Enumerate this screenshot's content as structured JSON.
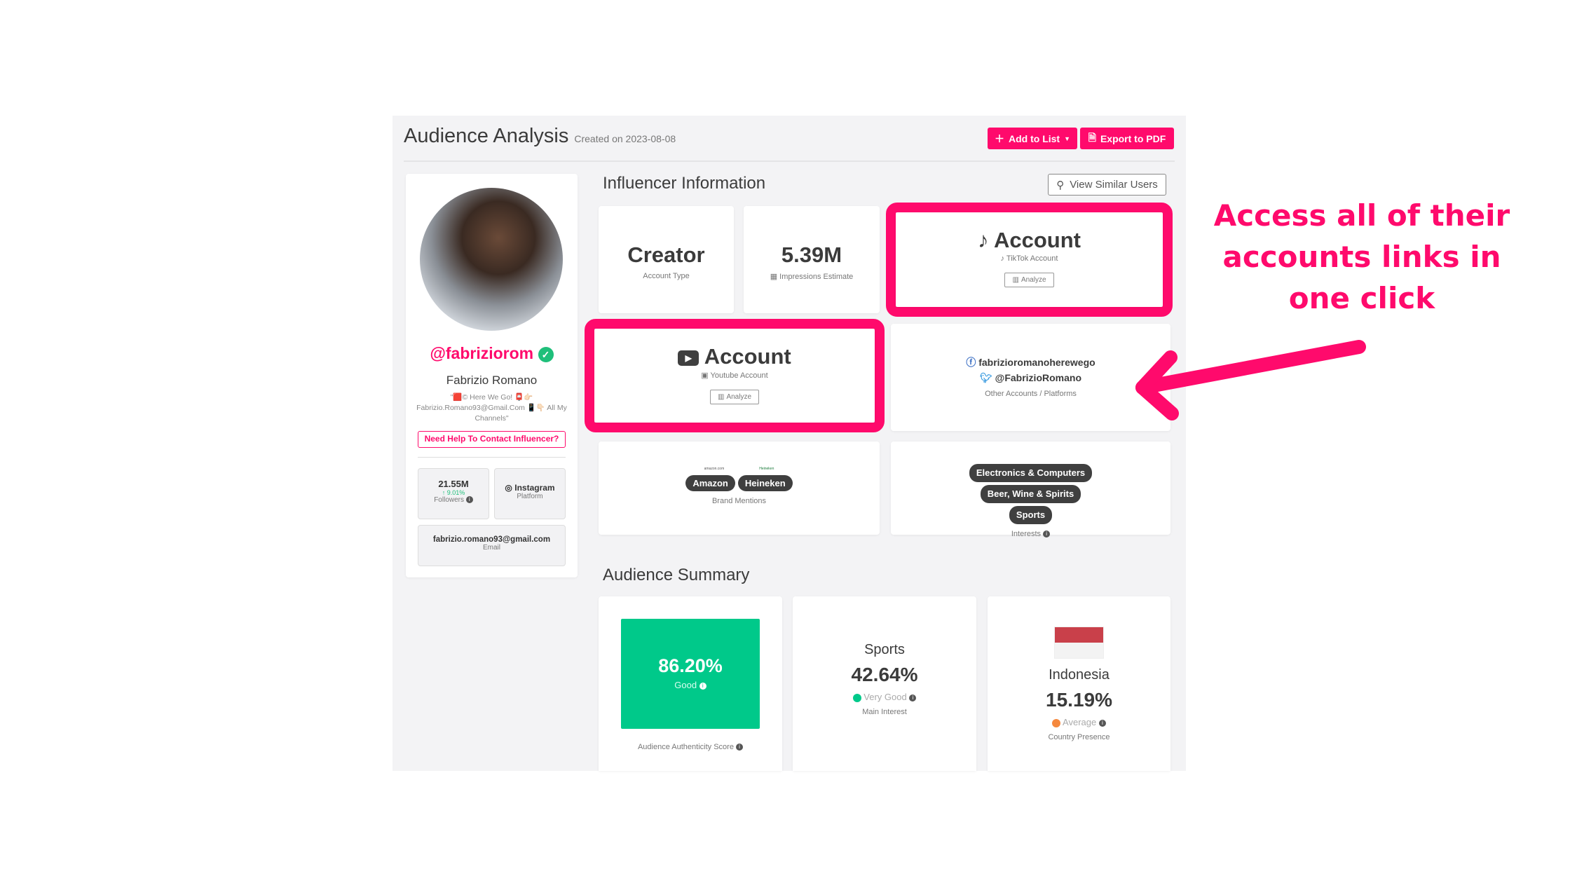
{
  "header": {
    "title": "Audience Analysis",
    "created": "Created on 2023-08-08",
    "add_to_list": "Add to List",
    "export_pdf": "Export to PDF"
  },
  "profile": {
    "handle": "@fabriziorom",
    "name": "Fabrizio Romano",
    "bio": "\"🟥© Here We Go! 📮👉🏻 Fabrizio.Romano93@Gmail.Com 📱👇🏻 All My Channels\"",
    "contact_button": "Need Help To Contact Influencer?",
    "followers": "21.55M",
    "growth": "9.01%",
    "followers_label": "Followers",
    "platform": "Instagram",
    "platform_label": "Platform",
    "email": "fabrizio.romano93@gmail.com",
    "email_label": "Email"
  },
  "influencer": {
    "heading": "Influencer Information",
    "view_similar": "View Similar Users",
    "account_type": {
      "value": "Creator",
      "label": "Account Type"
    },
    "impressions": {
      "value": "5.39M",
      "label": "Impressions Estimate"
    },
    "tiktok": {
      "title": "Account",
      "label": "TikTok Account",
      "analyze": "Analyze"
    },
    "youtube": {
      "title": "Account",
      "label": "Youtube Account",
      "analyze": "Analyze"
    },
    "other": {
      "facebook": "fabrizioromanoherewego",
      "twitter": "@FabrizioRomano",
      "label": "Other Accounts / Platforms"
    },
    "brands": {
      "items": [
        "Amazon",
        "Heineken"
      ],
      "logos": [
        "amazon.com",
        "Heineken"
      ],
      "label": "Brand Mentions"
    },
    "interests": {
      "items": [
        "Electronics & Computers",
        "Beer, Wine & Spirits",
        "Sports"
      ],
      "label": "Interests"
    }
  },
  "summary": {
    "heading": "Audience Summary",
    "authenticity": {
      "value": "86.20%",
      "rating": "Good",
      "label": "Audience Authenticity Score"
    },
    "interest": {
      "name": "Sports",
      "value": "42.64%",
      "rating": "Very Good",
      "label": "Main Interest"
    },
    "country": {
      "name": "Indonesia",
      "value": "15.19%",
      "rating": "Average",
      "label": "Country Presence"
    }
  },
  "annotation": {
    "lines": [
      "Access all of their",
      "accounts links in",
      "one click"
    ]
  },
  "colors": {
    "accent": "#ff0a6c",
    "good": "#00c98a",
    "average": "#f5883d",
    "flag_red": "#c9404a"
  }
}
